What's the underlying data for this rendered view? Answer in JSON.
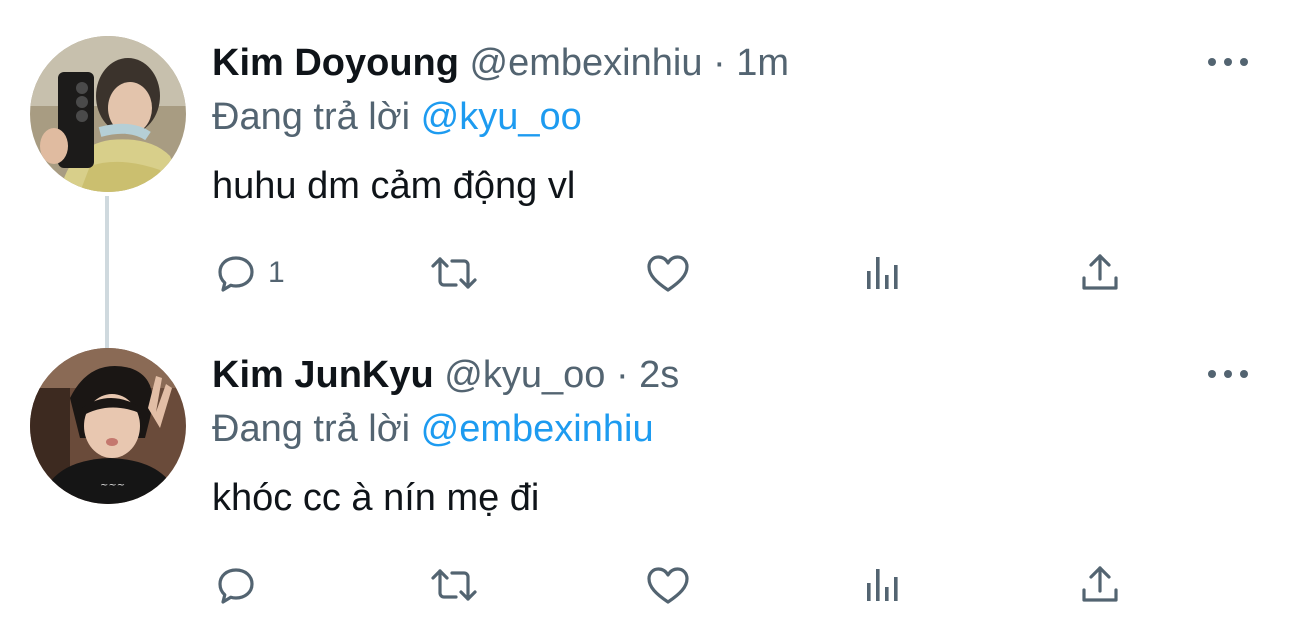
{
  "tweets": [
    {
      "name": "Kim Doyoung",
      "handle": "@embexinhiu",
      "separator": "·",
      "time": "1m",
      "reply_prefix": "Đang trả lời",
      "reply_to": "@kyu_oo",
      "text": "huhu dm cảm động vl",
      "reply_count": "1",
      "icons": [
        "reply-icon",
        "retweet-icon",
        "like-icon",
        "views-icon",
        "share-icon",
        "more-icon"
      ]
    },
    {
      "name": "Kim JunKyu",
      "handle": "@kyu_oo",
      "separator": "·",
      "time": "2s",
      "reply_prefix": "Đang trả lời",
      "reply_to": "@embexinhiu",
      "text": "khóc cc à nín mẹ đi",
      "reply_count": "",
      "icons": [
        "reply-icon",
        "retweet-icon",
        "like-icon",
        "views-icon",
        "share-icon",
        "more-icon"
      ]
    }
  ],
  "colors": {
    "text": "#0f1419",
    "secondary": "#536471",
    "mention": "#1d9bf0",
    "thread_line": "#cfd9de"
  }
}
